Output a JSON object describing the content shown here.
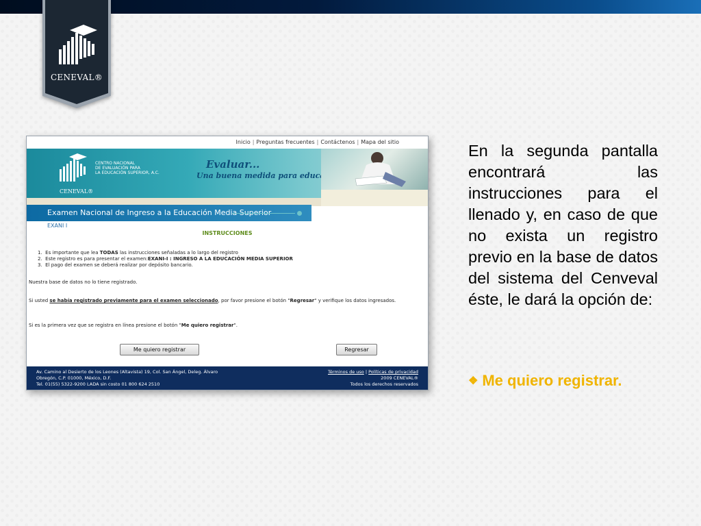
{
  "slide": {
    "logo_text": "CENEVAL®",
    "body_text": "En la segunda pantalla encontrará las instrucciones para el llenado y, en caso de que no exista un registro previo en la base de datos del sistema del Cenveval éste, le dará la opción de:",
    "bullet_text": "Me quiero registrar.",
    "bullet_icon": "diamond-bullet-icon",
    "colors": {
      "bullet": "#f0b400",
      "top_bar": "#021a3d"
    }
  },
  "website": {
    "topnav": {
      "items": [
        "Inicio",
        "Preguntas frecuentes",
        "Contáctenos",
        "Mapa del sitio"
      ],
      "separator": "|"
    },
    "banner": {
      "org_name_lines": [
        "CENTRO NACIONAL",
        "DE EVALUACIÓN PARA",
        "LA EDUCACIÓN SUPERIOR, A.C."
      ],
      "logo_text": "CENEVAL®",
      "slogan_1": "Evaluar...",
      "slogan_2": "Una buena medida para educar mejor"
    },
    "exam_title": "Examen Nacional de Ingreso a la Educación Media Superior",
    "exam_code": "EXANI I",
    "instructions_title": "INSTRUCCIONES",
    "instructions": [
      {
        "n": "1.",
        "pre": "Es importante que lea ",
        "bold": "TODAS",
        "post": " las instrucciones señaladas a lo largo del registro"
      },
      {
        "n": "2.",
        "pre": "Este registro es para presentar el examen:",
        "bold": "EXANI-I : INGRESO A LA EDUCACIÓN MEDIA SUPERIOR",
        "post": ""
      },
      {
        "n": "3.",
        "pre": "El pago del examen se deberá realizar por depósito bancario.",
        "bold": "",
        "post": ""
      }
    ],
    "not_registered": "Nuestra base de datos no lo tiene registrado.",
    "previous": {
      "pre": "Si usted ",
      "link": "se había registrado previamente para el examen seleccionado",
      "mid": ", por favor presione el botón \"",
      "bold": "Regresar",
      "post": "\" y verifique los datos ingresados."
    },
    "first_time": {
      "pre": "Si es la primera vez que se registra en línea presione el botón \"",
      "bold": "Me quiero registrar",
      "post": "\"."
    },
    "buttons": {
      "register": "Me quiero registrar",
      "back": "Regresar"
    },
    "footer": {
      "address_1": "Av. Camino al Desierto de los Leones (Altavista) 19, Col. San Ángel, Deleg. Álvaro",
      "address_2": "Obregón, C.P. 01000, México, D.F.",
      "address_3": "Tel. 01(55) 5322-9200 LADA sin costo 01 800 624 2510",
      "terms": "Términos de uso",
      "privacy": "Políticas de privacidad",
      "copyright": "2009 CENEVAL®",
      "rights": "Todos los derechos reservados"
    }
  }
}
